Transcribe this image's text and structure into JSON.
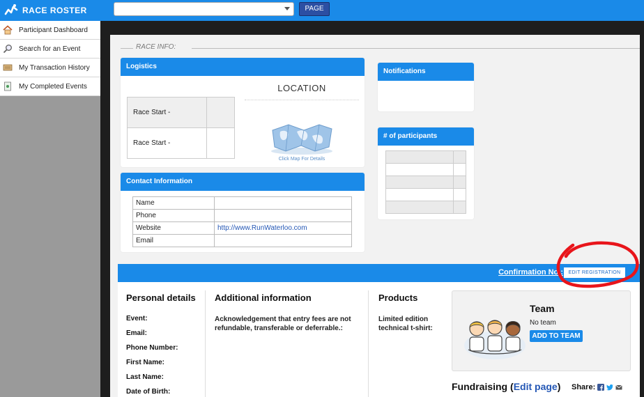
{
  "topbar": {
    "logo_text": "RACE ROSTER",
    "event_select_value": "",
    "page_button": "PAGE"
  },
  "sidebar": {
    "items": [
      {
        "label": "Participant Dashboard",
        "icon": "house-icon"
      },
      {
        "label": "Search for an Event",
        "icon": "magnifier-icon"
      },
      {
        "label": "My Transaction History",
        "icon": "ledger-icon"
      },
      {
        "label": "My Completed Events",
        "icon": "document-icon"
      }
    ]
  },
  "race_info": {
    "label": "RACE INFO:"
  },
  "logistics": {
    "title": "Logistics",
    "rows": [
      {
        "label": "Race Start -",
        "value": ""
      },
      {
        "label": "Race Start -",
        "value": ""
      }
    ],
    "location_title": "LOCATION",
    "map_link": "Click Map For Details"
  },
  "contact": {
    "title": "Contact Information",
    "rows": [
      {
        "key": "Name",
        "value": ""
      },
      {
        "key": "Phone",
        "value": ""
      },
      {
        "key": "Website",
        "value": "http://www.RunWaterloo.com"
      },
      {
        "key": "Email",
        "value": ""
      }
    ]
  },
  "notifications": {
    "title": "Notifications"
  },
  "participants": {
    "title": "# of participants"
  },
  "confirmation": {
    "label": "Confirmation No.:",
    "edit_button": "EDIT REGISTRATION"
  },
  "personal": {
    "title": "Personal details",
    "fields": [
      "Event:",
      "Email:",
      "Phone Number:",
      "First Name:",
      "Last Name:",
      "Date of Birth:"
    ]
  },
  "additional": {
    "title": "Additional information",
    "ack": "Acknowledgement that entry fees are not refundable, transferable or deferrable.:"
  },
  "products": {
    "title": "Products",
    "item": "Limited edition technical t-shirt:"
  },
  "team": {
    "title": "Team",
    "status": "No team",
    "add_button": "ADD TO TEAM"
  },
  "fundraising": {
    "title": "Fundraising",
    "open_paren": "(",
    "edit_link": "Edit page",
    "close_paren": ")",
    "share_label": "Share:"
  },
  "colors": {
    "brand_blue": "#1a8ae8",
    "annotation_red": "#e8151b"
  }
}
